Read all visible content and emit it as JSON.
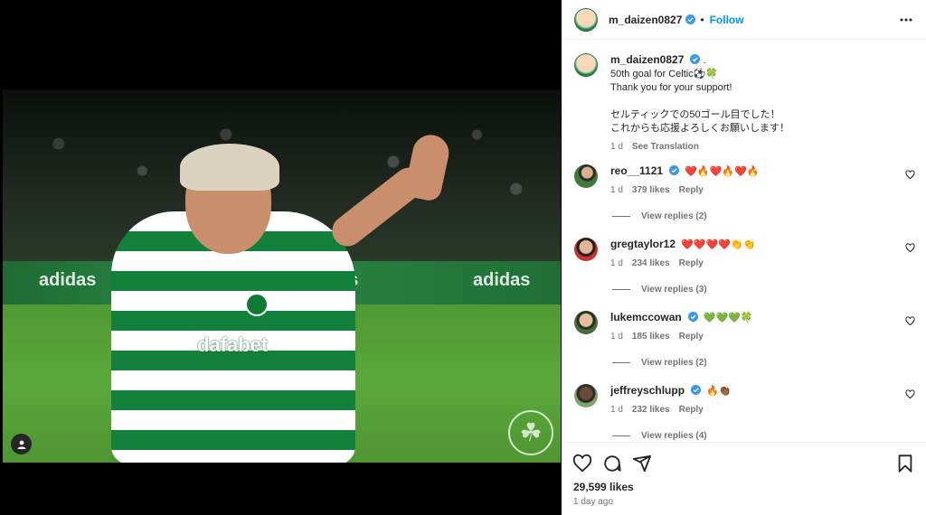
{
  "post": {
    "author": "m_daizen0827",
    "follow_label": "Follow",
    "dot": "•",
    "caption": {
      "username": "m_daizen0827",
      "trailing": ".",
      "lines": [
        "50th goal for Celtic⚽️🍀",
        "Thank you for your support!",
        "",
        "セルティックでの50ゴール目でした！",
        "これからも応援よろしくお願いします！"
      ],
      "time": "1 d",
      "translate_label": "See Translation"
    }
  },
  "comments": [
    {
      "username": "reo__1121",
      "text": "❤️🔥❤️🔥❤️🔥",
      "time": "1 d",
      "likes": "379 likes",
      "reply_label": "Reply",
      "view_replies": "View replies (2)"
    },
    {
      "username": "gregtaylor12",
      "text": "❤️❤️❤️❤️👏👏",
      "time": "1 d",
      "likes": "234 likes",
      "reply_label": "Reply",
      "view_replies": "View replies (3)"
    },
    {
      "username": "lukemccowan",
      "text": "💚💚💚🍀",
      "time": "1 d",
      "likes": "185 likes",
      "reply_label": "Reply",
      "view_replies": "View replies (2)"
    },
    {
      "username": "jeffreyschlupp",
      "text": "🔥👏🏾",
      "time": "1 d",
      "likes": "232 likes",
      "reply_label": "Reply",
      "view_replies": "View replies (4)"
    }
  ],
  "footer": {
    "likes": "29,599 likes",
    "posted": "1 day ago"
  },
  "image": {
    "sponsor": "dafabet",
    "adboard_text": "adidas"
  },
  "colors": {
    "link_blue": "#0095f6",
    "celtic_green": "#13803b",
    "verified_blue": "#3897f0"
  },
  "icons": [
    "more-options-icon",
    "verified-badge-icon",
    "heart-icon",
    "comment-icon",
    "share-icon",
    "bookmark-icon",
    "tagged-user-icon",
    "celtic-crest-watermark"
  ]
}
